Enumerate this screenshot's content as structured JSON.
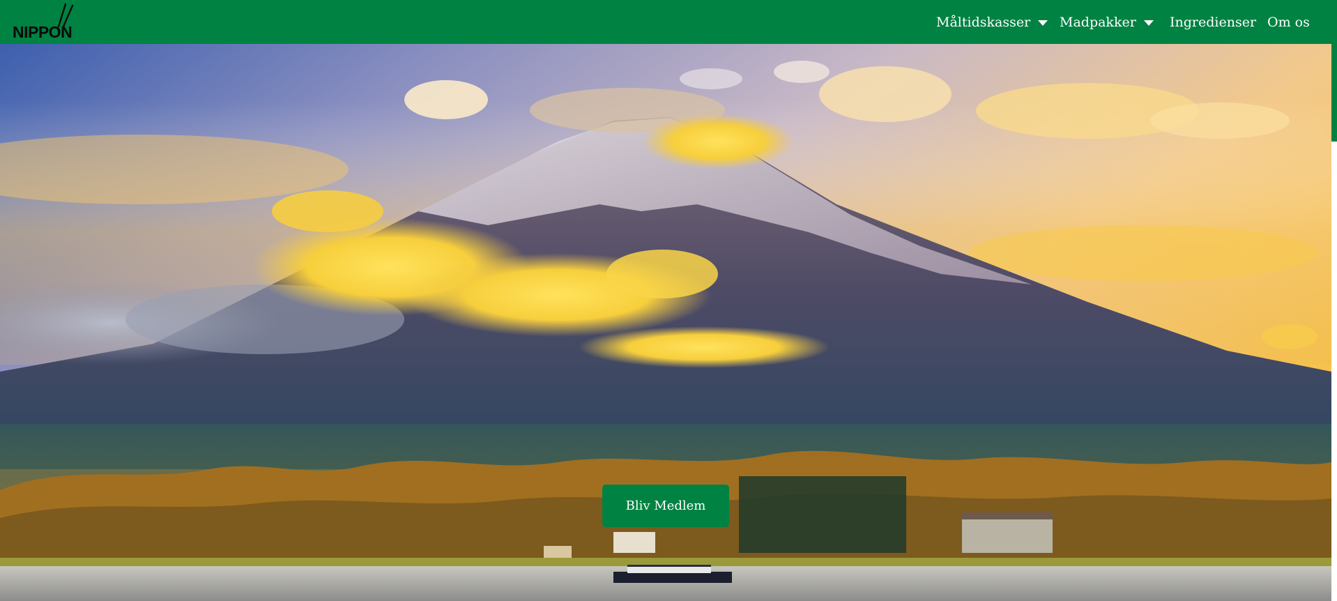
{
  "brand": {
    "logo_text": "NIPPON",
    "logo_icon": "chopsticks-icon"
  },
  "nav": {
    "items": [
      {
        "label": "Måltidskasser",
        "has_dropdown": true,
        "icon": "caret-down-icon"
      },
      {
        "label": "Madpakker",
        "has_dropdown": true,
        "icon": "caret-down-icon"
      },
      {
        "label": "Ingredienser",
        "has_dropdown": false
      },
      {
        "label": "Om os",
        "has_dropdown": false
      }
    ]
  },
  "hero": {
    "cta_label": "Bliv Medlem"
  },
  "colors": {
    "brand_green": "#008242",
    "nav_text": "#ffffff",
    "logo_text": "#0a0a0a"
  }
}
